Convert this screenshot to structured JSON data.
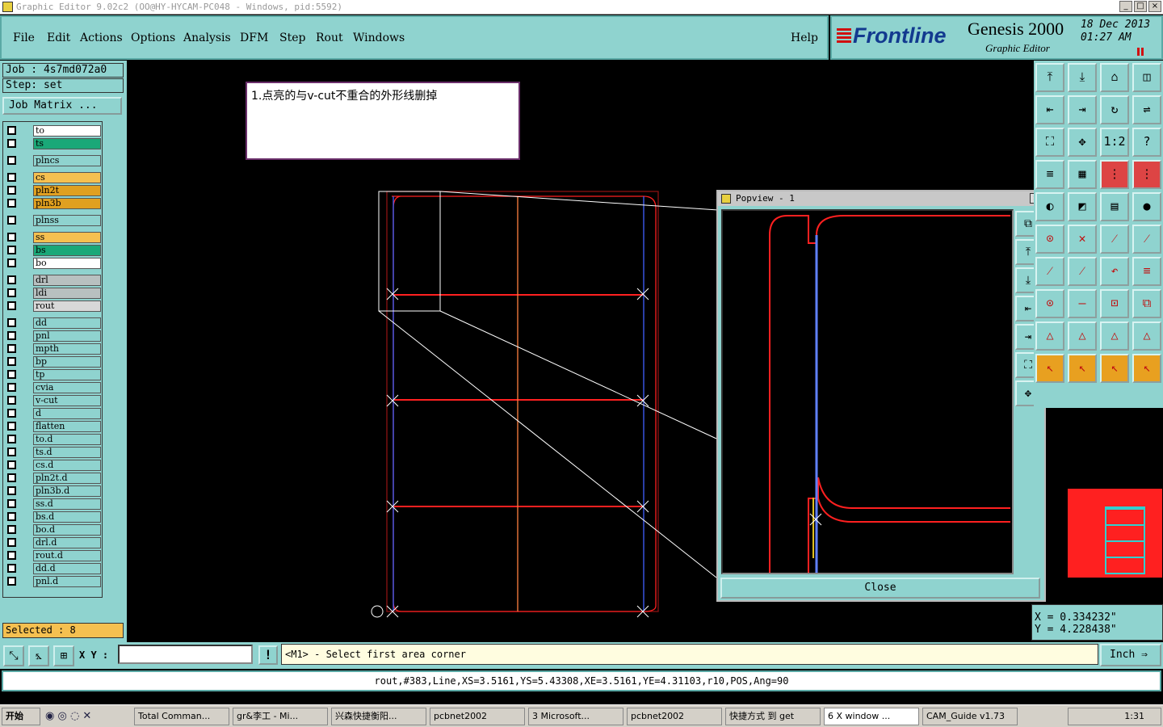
{
  "window": {
    "title": "Graphic Editor 9.02c2 (OO@HY-HYCAM-PC048 - Windows, pid:5592)"
  },
  "menu": [
    "File",
    "Edit",
    "Actions",
    "Options",
    "Analysis",
    "DFM",
    "Step",
    "Rout",
    "Windows"
  ],
  "menu_help": "Help",
  "brand": {
    "logo": "Frontline",
    "product": "Genesis 2000",
    "sub": "Graphic Editor",
    "date": "18 Dec 2013",
    "time": "01:27 AM"
  },
  "job": {
    "job": "Job : 4s7md072a0",
    "step": "Step: set",
    "matrix": "Job Matrix ..."
  },
  "layers": [
    {
      "name": "to",
      "color": "#ffffff"
    },
    {
      "name": "ts",
      "color": "#1aa878"
    },
    {
      "gap": true
    },
    {
      "name": "plncs",
      "color": "#8fd3cf"
    },
    {
      "gap": true
    },
    {
      "name": "cs",
      "color": "#f5c050"
    },
    {
      "name": "pln2t",
      "color": "#e0a020"
    },
    {
      "name": "pln3b",
      "color": "#e0a020"
    },
    {
      "gap": true
    },
    {
      "name": "plnss",
      "color": "#8fd3cf"
    },
    {
      "gap": true
    },
    {
      "name": "ss",
      "color": "#f5c050"
    },
    {
      "name": "bs",
      "color": "#1aa878"
    },
    {
      "name": "bo",
      "color": "#ffffff"
    },
    {
      "gap": true
    },
    {
      "name": "drl",
      "color": "#b8c0c0"
    },
    {
      "name": "ldi",
      "color": "#b8c0c0"
    },
    {
      "name": "rout",
      "color": "#d8d8d8"
    },
    {
      "gap": true
    },
    {
      "name": "dd",
      "color": "#8fd3cf"
    },
    {
      "name": "pnl",
      "color": "#8fd3cf"
    },
    {
      "name": "mpth",
      "color": "#8fd3cf"
    },
    {
      "name": "bp",
      "color": "#8fd3cf"
    },
    {
      "name": "tp",
      "color": "#8fd3cf"
    },
    {
      "name": "cvia",
      "color": "#8fd3cf"
    },
    {
      "name": "v-cut",
      "color": "#8fd3cf"
    },
    {
      "name": "d",
      "color": "#8fd3cf"
    },
    {
      "name": "flatten",
      "color": "#8fd3cf"
    },
    {
      "name": "to.d",
      "color": "#8fd3cf"
    },
    {
      "name": "ts.d",
      "color": "#8fd3cf"
    },
    {
      "name": "cs.d",
      "color": "#8fd3cf"
    },
    {
      "name": "pln2t.d",
      "color": "#8fd3cf"
    },
    {
      "name": "pln3b.d",
      "color": "#8fd3cf"
    },
    {
      "name": "ss.d",
      "color": "#8fd3cf"
    },
    {
      "name": "bs.d",
      "color": "#8fd3cf"
    },
    {
      "name": "bo.d",
      "color": "#8fd3cf"
    },
    {
      "name": "drl.d",
      "color": "#8fd3cf"
    },
    {
      "name": "rout.d",
      "color": "#8fd3cf"
    },
    {
      "name": "dd.d",
      "color": "#8fd3cf"
    },
    {
      "name": "pnl.d",
      "color": "#8fd3cf"
    }
  ],
  "selected": "Selected : 8",
  "note": "1.点亮的与v-cut不重合的外形线删掉",
  "popview": {
    "title": "Popview - 1",
    "close": "Close"
  },
  "coords": {
    "x": "X = 0.334232\"",
    "y": "Y = 4.228438\""
  },
  "cmd": {
    "xy_label": "X Y :",
    "prompt": "<M1> - Select first area corner",
    "units": "Inch"
  },
  "status": "rout,#383,Line,XS=3.5161,YS=5.43308,XE=3.5161,YE=4.31103,r10,POS,Ang=90",
  "taskbar": {
    "start": "开始",
    "clock": "1:31",
    "items": [
      "Total Comman...",
      "gr&李工 - Mi...",
      "兴森快捷衡阳...",
      "pcbnet2002",
      "3 Microsoft...",
      "pcbnet2002",
      "快捷方式 到 get",
      "6 X window ...",
      "CAM_Guide v1.73"
    ]
  }
}
